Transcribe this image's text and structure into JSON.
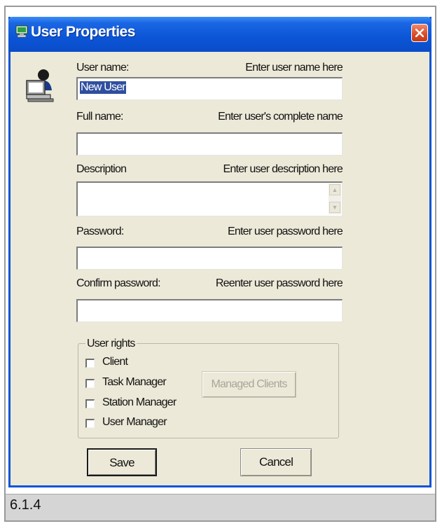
{
  "window": {
    "title": "User Properties",
    "icons": {
      "app": "monitor-app-icon",
      "close": "close-x-icon",
      "user": "user-computer-icon"
    }
  },
  "form": {
    "user_name": {
      "label": "User name:",
      "hint": "Enter user name here",
      "value": "New User"
    },
    "full_name": {
      "label": "Full name:",
      "hint": "Enter user's complete name",
      "value": ""
    },
    "description": {
      "label": "Description",
      "hint": "Enter user description here",
      "value": ""
    },
    "password": {
      "label": "Password:",
      "hint": "Enter user password here",
      "value": ""
    },
    "confirm_password": {
      "label": "Confirm password:",
      "hint": "Reenter user password here",
      "value": ""
    }
  },
  "user_rights": {
    "title": "User rights",
    "options": [
      {
        "label": "Client",
        "checked": false
      },
      {
        "label": "Task Manager",
        "checked": false
      },
      {
        "label": "Station Manager",
        "checked": false
      },
      {
        "label": "User Manager",
        "checked": false
      }
    ],
    "managed_clients_label": "Managed Clients"
  },
  "buttons": {
    "save": "Save",
    "cancel": "Cancel"
  },
  "caption": "6.1.4",
  "colors": {
    "titlebar": "#0a55d6",
    "dialog": "#ece9d8",
    "close": "#d94b28",
    "selection": "#2f4f9f"
  }
}
